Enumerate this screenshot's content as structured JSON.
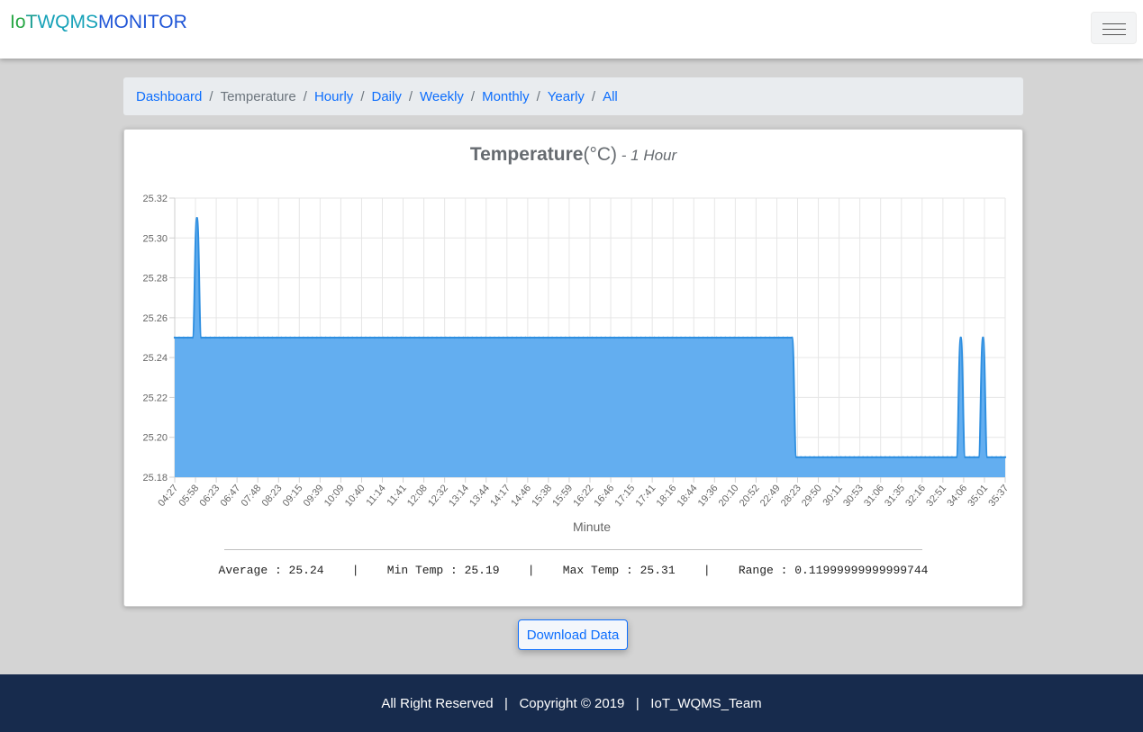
{
  "brand": {
    "parts": [
      {
        "text": "Io",
        "color": "#28a745"
      },
      {
        "text": "T",
        "color": "#1b9e93"
      },
      {
        "text": "WQMS",
        "color": "#17a2b8"
      },
      {
        "text": "MONITOR",
        "color": "#1f55d6"
      }
    ]
  },
  "breadcrumb": {
    "items": [
      {
        "label": "Dashboard",
        "active": false
      },
      {
        "label": "Temperature",
        "active": true
      },
      {
        "label": "Hourly",
        "active": false
      },
      {
        "label": "Daily",
        "active": false
      },
      {
        "label": "Weekly",
        "active": false
      },
      {
        "label": "Monthly",
        "active": false
      },
      {
        "label": "Yearly",
        "active": false
      },
      {
        "label": "All",
        "active": false
      }
    ],
    "separator": "/"
  },
  "card": {
    "title_main": "Temperature",
    "title_unit": "(°C)",
    "title_sub": " - 1 Hour"
  },
  "chart_data": {
    "type": "area",
    "xlabel": "Minute",
    "ylabel": "",
    "ylim": [
      25.18,
      25.32
    ],
    "yticks": [
      "25.32",
      "25.30",
      "25.28",
      "25.26",
      "25.24",
      "25.22",
      "25.20",
      "25.18"
    ],
    "x_tick_labels": [
      "04:27",
      "05:58",
      "06:23",
      "06:47",
      "07:48",
      "08:23",
      "09:15",
      "09:39",
      "10:09",
      "10:40",
      "11:14",
      "11:41",
      "12:08",
      "12:32",
      "13:14",
      "13:44",
      "14:17",
      "14:46",
      "15:38",
      "15:59",
      "16:22",
      "16:46",
      "17:15",
      "17:41",
      "18:16",
      "18:44",
      "19:36",
      "20:10",
      "20:52",
      "22:49",
      "28:23",
      "29:50",
      "30:11",
      "30:53",
      "31:06",
      "31:35",
      "32:16",
      "32:51",
      "34:06",
      "35:01",
      "35:37"
    ],
    "series": [
      {
        "values": [
          25.25,
          25.25,
          25.25,
          25.25,
          25.25,
          25.31,
          25.25,
          25.25,
          25.25,
          25.25,
          25.25,
          25.25,
          25.25,
          25.25,
          25.25,
          25.25,
          25.25,
          25.25,
          25.25,
          25.25,
          25.25,
          25.25,
          25.25,
          25.25,
          25.25,
          25.25,
          25.25,
          25.25,
          25.25,
          25.25,
          25.25,
          25.25,
          25.25,
          25.25,
          25.25,
          25.25,
          25.25,
          25.25,
          25.25,
          25.25,
          25.25,
          25.25,
          25.25,
          25.25,
          25.25,
          25.25,
          25.25,
          25.25,
          25.25,
          25.25,
          25.25,
          25.25,
          25.25,
          25.25,
          25.25,
          25.25,
          25.25,
          25.25,
          25.25,
          25.25,
          25.25,
          25.25,
          25.25,
          25.25,
          25.25,
          25.25,
          25.25,
          25.25,
          25.25,
          25.25,
          25.25,
          25.25,
          25.25,
          25.25,
          25.25,
          25.25,
          25.25,
          25.25,
          25.25,
          25.25,
          25.25,
          25.25,
          25.25,
          25.25,
          25.25,
          25.25,
          25.25,
          25.25,
          25.25,
          25.25,
          25.25,
          25.25,
          25.25,
          25.25,
          25.25,
          25.25,
          25.25,
          25.25,
          25.25,
          25.25,
          25.25,
          25.25,
          25.25,
          25.25,
          25.25,
          25.25,
          25.25,
          25.25,
          25.25,
          25.25,
          25.25,
          25.25,
          25.25,
          25.25,
          25.25,
          25.25,
          25.25,
          25.25,
          25.25,
          25.25,
          25.25,
          25.25,
          25.25,
          25.25,
          25.25,
          25.25,
          25.25,
          25.25,
          25.25,
          25.25,
          25.25,
          25.25,
          25.25,
          25.25,
          25.25,
          25.25,
          25.25,
          25.25,
          25.25,
          25.25,
          25.19,
          25.19,
          25.19,
          25.19,
          25.19,
          25.19,
          25.19,
          25.19,
          25.19,
          25.19,
          25.19,
          25.19,
          25.19,
          25.19,
          25.19,
          25.19,
          25.19,
          25.19,
          25.19,
          25.19,
          25.19,
          25.19,
          25.19,
          25.19,
          25.19,
          25.19,
          25.19,
          25.19,
          25.19,
          25.19,
          25.19,
          25.19,
          25.19,
          25.19,
          25.19,
          25.19,
          25.19,
          25.25,
          25.19,
          25.19,
          25.19,
          25.19,
          25.25,
          25.19,
          25.19,
          25.19,
          25.19,
          25.19
        ]
      }
    ],
    "fill_color": "#63aef0",
    "line_color": "#2f8fe0",
    "grid": true
  },
  "stats": {
    "text": "Average : 25.24    |    Min Temp : 25.19    |    Max Temp : 25.31    |    Range : 0.11999999999999744"
  },
  "download_button": "Download Data",
  "footer": {
    "text": "All Right Reserved   |   Copyright © 2019   |   IoT_WQMS_Team"
  },
  "colors": {
    "link": "#0d6efd",
    "footer_bg": "#172b4d"
  }
}
